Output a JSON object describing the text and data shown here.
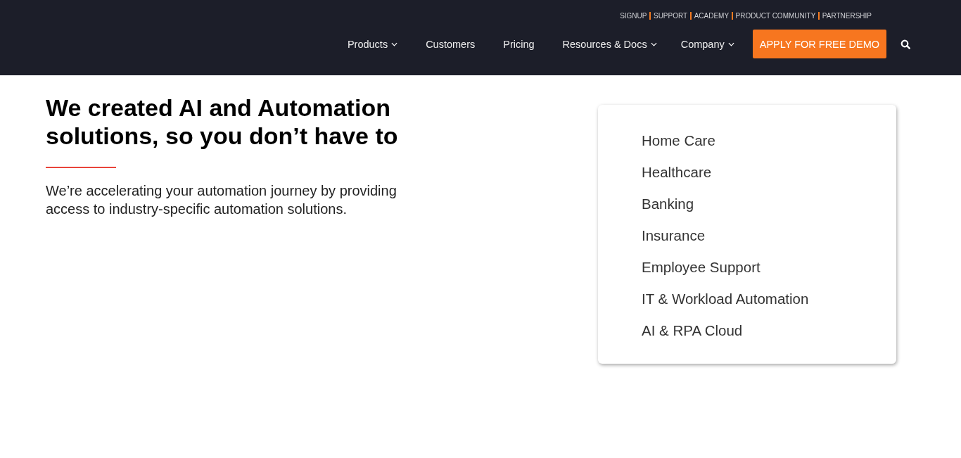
{
  "top_links": [
    "SIGNUP",
    "SUPPORT",
    "ACADEMY",
    "PRODUCT COMMUNITY",
    "PARTNERSHIP"
  ],
  "nav": [
    {
      "label": "Products",
      "has_dropdown": true
    },
    {
      "label": "Customers",
      "has_dropdown": false
    },
    {
      "label": "Pricing",
      "has_dropdown": false
    },
    {
      "label": "Resources & Docs",
      "has_dropdown": true
    },
    {
      "label": "Company",
      "has_dropdown": true
    }
  ],
  "cta": "APPLY FOR FREE DEMO",
  "hero": {
    "title": "We created AI and Automation solutions, so you don’t have to",
    "subtitle": "We’re accelerating your automation journey by providing access to industry-specific automation solutions."
  },
  "solutions": [
    "Home Care",
    "Healthcare",
    "Banking",
    "Insurance",
    "Employee Support",
    "IT & Workload Automation",
    "AI & RPA Cloud"
  ]
}
